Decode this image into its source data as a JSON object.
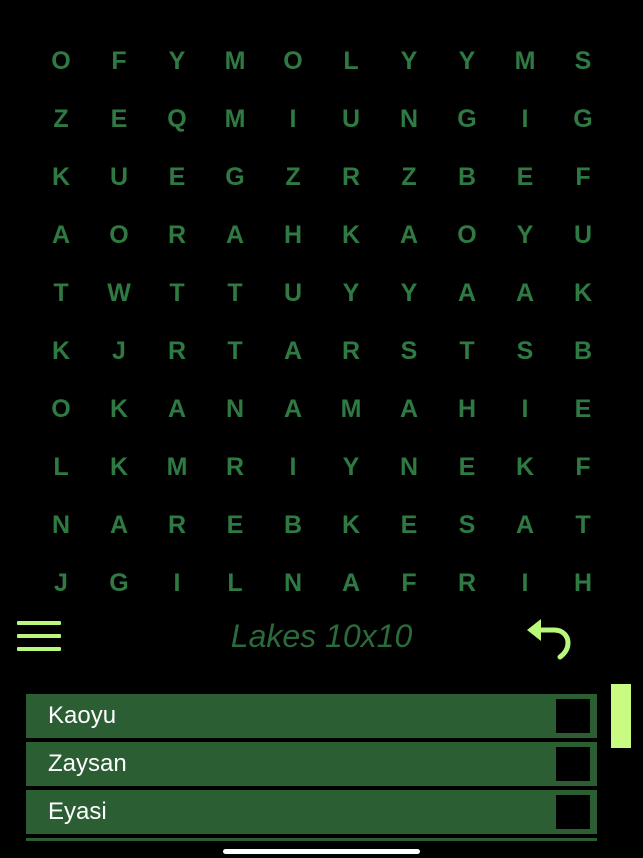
{
  "grid": {
    "rows": [
      [
        "O",
        "F",
        "Y",
        "M",
        "O",
        "L",
        "Y",
        "Y",
        "M",
        "S"
      ],
      [
        "Z",
        "E",
        "Q",
        "M",
        "I",
        "U",
        "N",
        "G",
        "I",
        "G"
      ],
      [
        "K",
        "U",
        "E",
        "G",
        "Z",
        "R",
        "Z",
        "B",
        "E",
        "F"
      ],
      [
        "A",
        "O",
        "R",
        "A",
        "H",
        "K",
        "A",
        "O",
        "Y",
        "U"
      ],
      [
        "T",
        "W",
        "T",
        "T",
        "U",
        "Y",
        "Y",
        "A",
        "A",
        "K"
      ],
      [
        "K",
        "J",
        "R",
        "T",
        "A",
        "R",
        "S",
        "T",
        "S",
        "B"
      ],
      [
        "O",
        "K",
        "A",
        "N",
        "A",
        "M",
        "A",
        "H",
        "I",
        "E"
      ],
      [
        "L",
        "K",
        "M",
        "R",
        "I",
        "Y",
        "N",
        "E",
        "K",
        "F"
      ],
      [
        "N",
        "A",
        "R",
        "E",
        "B",
        "K",
        "E",
        "S",
        "A",
        "T"
      ],
      [
        "J",
        "G",
        "I",
        "L",
        "N",
        "A",
        "F",
        "R",
        "I",
        "H"
      ]
    ]
  },
  "toolbar": {
    "menu_icon": "hamburger-menu-icon",
    "title": "Lakes 10x10",
    "undo_icon": "undo-arrow-icon"
  },
  "words": [
    {
      "label": "Kaoyu",
      "found": false
    },
    {
      "label": "Zaysan",
      "found": false
    },
    {
      "label": "Eyasi",
      "found": false
    }
  ],
  "colors": {
    "background": "#000000",
    "grid_letter": "#2f7a42",
    "accent": "#b8f87a",
    "word_row": "#2c5e34",
    "title": "#2b6a3b"
  }
}
